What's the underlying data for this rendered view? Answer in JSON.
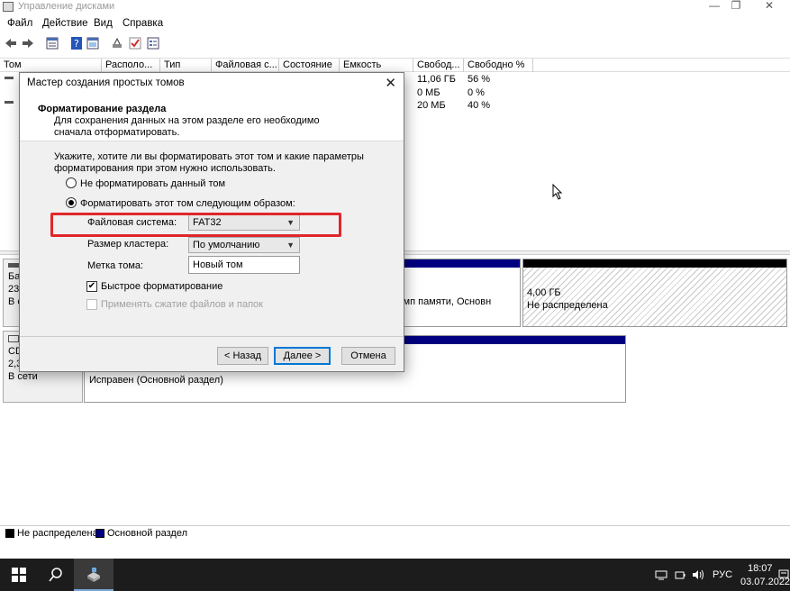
{
  "window": {
    "title": "Управление дисками",
    "minimize": "—",
    "maximize": "❐",
    "close": "✕"
  },
  "menu": [
    "Файл",
    "Действие",
    "Вид",
    "Справка"
  ],
  "columns": [
    "Том",
    "Располо...",
    "Тип",
    "Файловая с...",
    "Состояние",
    "Емкость",
    "Свобод...",
    "Свободно %"
  ],
  "volume_rows": [
    {
      "free": "11,06 ГБ",
      "free_pct": "56 %"
    },
    {
      "free": "0 МБ",
      "free_pct": "0 %"
    },
    {
      "free": "20 МБ",
      "free_pct": "40 %"
    }
  ],
  "disks": [
    {
      "lines": [
        "Ба",
        "23,",
        "В с"
      ],
      "partition_text": "Исправен (Файл подкачки, Аварийный дамп памяти, Основн",
      "partition_visible": "дамп памяти, Основн",
      "unalloc_size": "4,00 ГБ",
      "unalloc_label": "Не распределена"
    },
    {
      "lines": [
        "CD",
        "2,3",
        "В сети"
      ],
      "partition_text": "Исправен (Основной раздел)"
    }
  ],
  "legend": {
    "unallocated": "Не распределена",
    "primary": "Основной раздел",
    "unallocated_color": "#000000",
    "primary_color": "#000080"
  },
  "dialog": {
    "title": "Мастер создания простых томов",
    "close": "✕",
    "header_title": "Форматирование раздела",
    "header_desc": "Для сохранения данных на этом разделе его необходимо сначала отформатировать.",
    "instruction": "Укажите, хотите ли вы форматировать этот том и какие параметры форматирования при этом нужно использовать.",
    "radio_no_format": "Не форматировать данный том",
    "radio_format": "Форматировать этот том следующим образом:",
    "fs_label": "Файловая система:",
    "fs_value": "FAT32",
    "cluster_label": "Размер кластера:",
    "cluster_value": "По умолчанию",
    "volume_label_label": "Метка тома:",
    "volume_label_value": "Новый том",
    "quick_format": "Быстрое форматирование",
    "compression": "Применять сжатие файлов и папок",
    "btn_back": "< Назад",
    "btn_next": "Далее >",
    "btn_cancel": "Отмена",
    "highlight_color": "#e0262a"
  },
  "taskbar": {
    "lang": "РУС",
    "time": "18:07",
    "date": "03.07.2022"
  }
}
